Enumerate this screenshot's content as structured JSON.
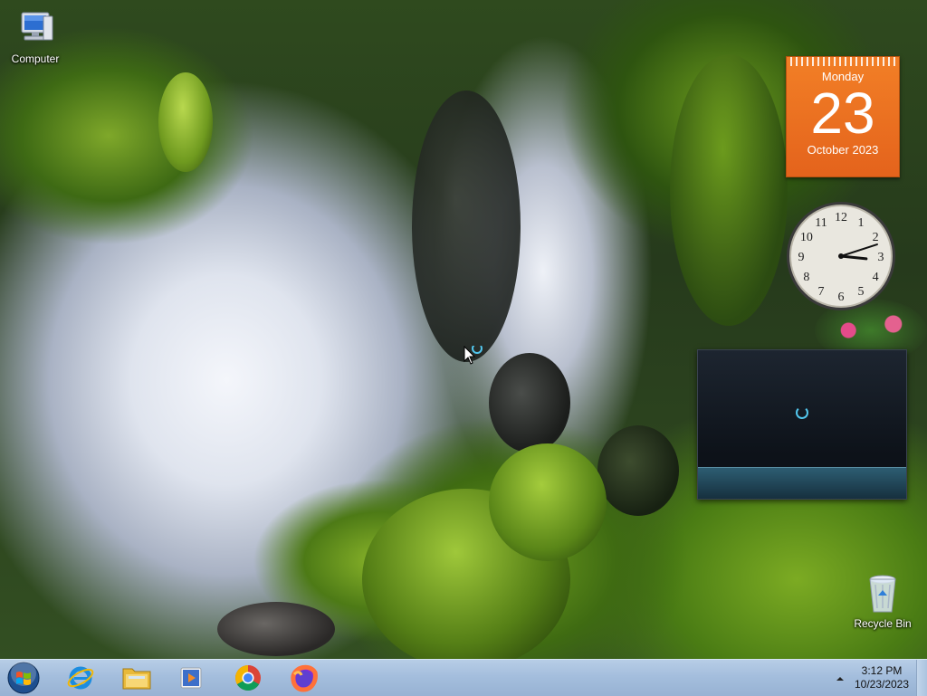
{
  "desktop": {
    "icons": [
      {
        "label": "Computer",
        "icon": "computer-icon"
      },
      {
        "label": "Recycle Bin",
        "icon": "recycle-bin-icon"
      }
    ]
  },
  "gadgets": {
    "calendar": {
      "weekday": "Monday",
      "day": "23",
      "month_year": "October 2023",
      "color": "#ee7222"
    },
    "clock": {
      "hour": 3,
      "minute": 12,
      "numerals": [
        "12",
        "1",
        "2",
        "3",
        "4",
        "5",
        "6",
        "7",
        "8",
        "9",
        "10",
        "11"
      ]
    },
    "media": {
      "state": "loading"
    }
  },
  "taskbar": {
    "start": "start-orb-icon",
    "pinned": [
      {
        "name": "internet-explorer",
        "icon": "internet-explorer-icon"
      },
      {
        "name": "file-explorer",
        "icon": "folder-icon"
      },
      {
        "name": "media-player",
        "icon": "media-player-icon"
      },
      {
        "name": "chrome",
        "icon": "chrome-icon"
      },
      {
        "name": "firefox",
        "icon": "firefox-icon"
      }
    ],
    "tray": {
      "overflow": "show-hidden-icons-arrow",
      "time": "3:12 PM",
      "date": "10/23/2023"
    }
  }
}
